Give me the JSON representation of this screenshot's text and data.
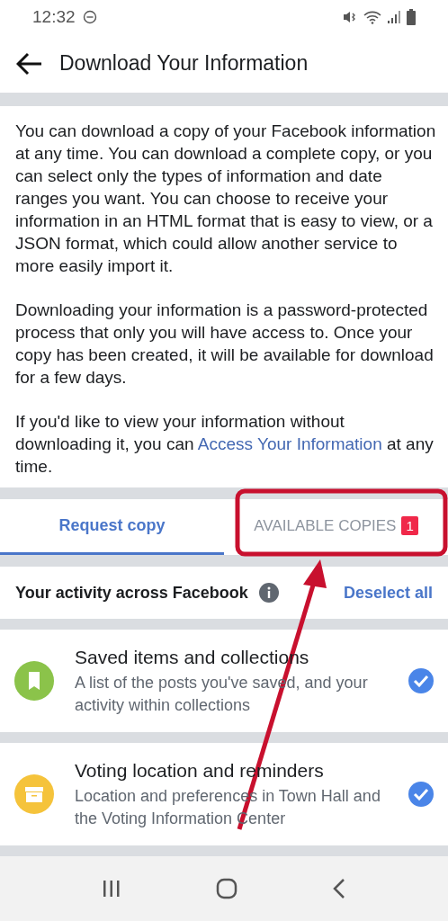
{
  "status_bar": {
    "time": "12:32"
  },
  "header": {
    "title": "Download Your Information"
  },
  "intro": [
    "You can download a copy of your Facebook information at any time. You can download a complete copy, or you can select only the types of information and date ranges you want. You can choose to receive your information in an HTML format that is easy to view, or a JSON format, which could allow another service to more easily import it.",
    "Downloading your information is a password-protected process that only you will have access to. Once your copy has been created, it will be available for download for a few days."
  ],
  "intro_link_paragraph": {
    "before": "If you'd like to view your information without downloading it, you can",
    "link": "Access Your Information",
    "after": "at any time."
  },
  "tabs": [
    {
      "label": "Request copy",
      "selected": true
    },
    {
      "label": "AVAILABLE COPIES",
      "selected": false,
      "badge": "1"
    }
  ],
  "section": {
    "title": "Your activity across Facebook",
    "action": "Deselect all"
  },
  "items": [
    {
      "kind": "bookmark",
      "color": "#8bc34a",
      "title": "Saved items and collections",
      "description": "A list of the posts you've saved, and your activity within collections",
      "checked": true
    },
    {
      "kind": "ballot",
      "color": "#f5c33b",
      "title": "Voting location and reminders",
      "description": "Location and preferences in Town Hall and the Voting Information Center",
      "checked": true
    }
  ]
}
